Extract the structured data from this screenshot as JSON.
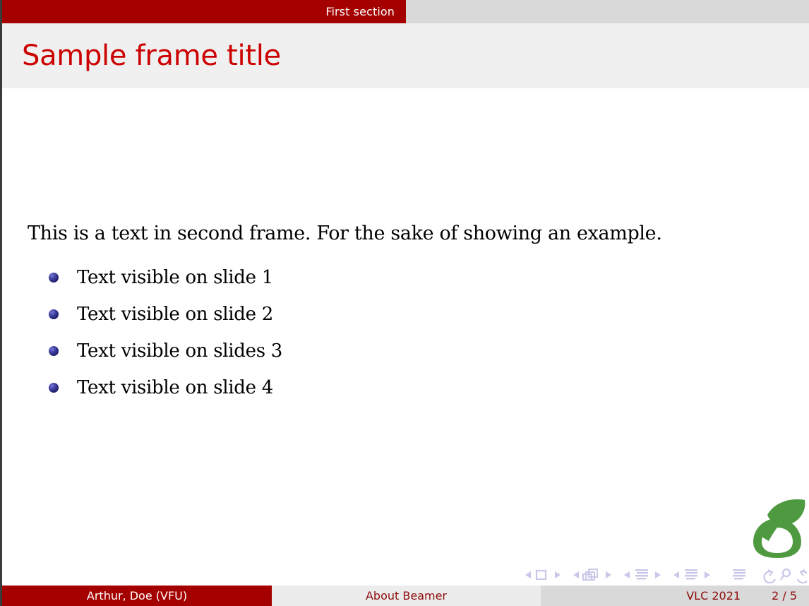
{
  "slide": {
    "headline": {
      "section_label": "First section",
      "section_bg": "#a50000",
      "rest_bg": "#d9d9d9",
      "section_text_color": "#ffffff"
    },
    "frame_title": {
      "text": "Sample frame title",
      "color": "#cc0101",
      "background": "#f0f0f0"
    },
    "body": {
      "intro_text": "This is a text in second frame.  For the sake of showing an example.",
      "bullets": [
        {
          "label": "Text visible on slide 1"
        },
        {
          "label": "Text visible on slide 2"
        },
        {
          "label": "Text visible on slides 3"
        },
        {
          "label": "Text visible on slide 4"
        }
      ],
      "bullet_color": "#262678",
      "text_color": "#000000"
    },
    "logo": {
      "name": "overleaf-logo",
      "color": "#4f9a41"
    },
    "navigation_symbols": {
      "color": "#c8c8e8",
      "items": [
        "prev-slide-arrow",
        "slide-square-icon",
        "next-slide-arrow",
        "prev-frame-arrow",
        "frames-stack-icon",
        "next-frame-arrow",
        "prev-subsection-arrow",
        "subsection-lines-icon",
        "next-subsection-arrow",
        "prev-section-arrow",
        "section-lines-icon",
        "next-section-arrow",
        "presentation-lines-icon",
        "back-circle-arrow",
        "search-magnifier-icon",
        "forward-circle-arrow"
      ]
    },
    "footline": {
      "author": "Arthur, Doe  (VFU)",
      "title": "About Beamer",
      "date": "VLC 2021",
      "page": "2 / 5",
      "author_bg": "#a50000",
      "title_bg": "#ececec",
      "meta_bg": "#d9d9d9",
      "accent_text": "#8e0c0c"
    }
  }
}
